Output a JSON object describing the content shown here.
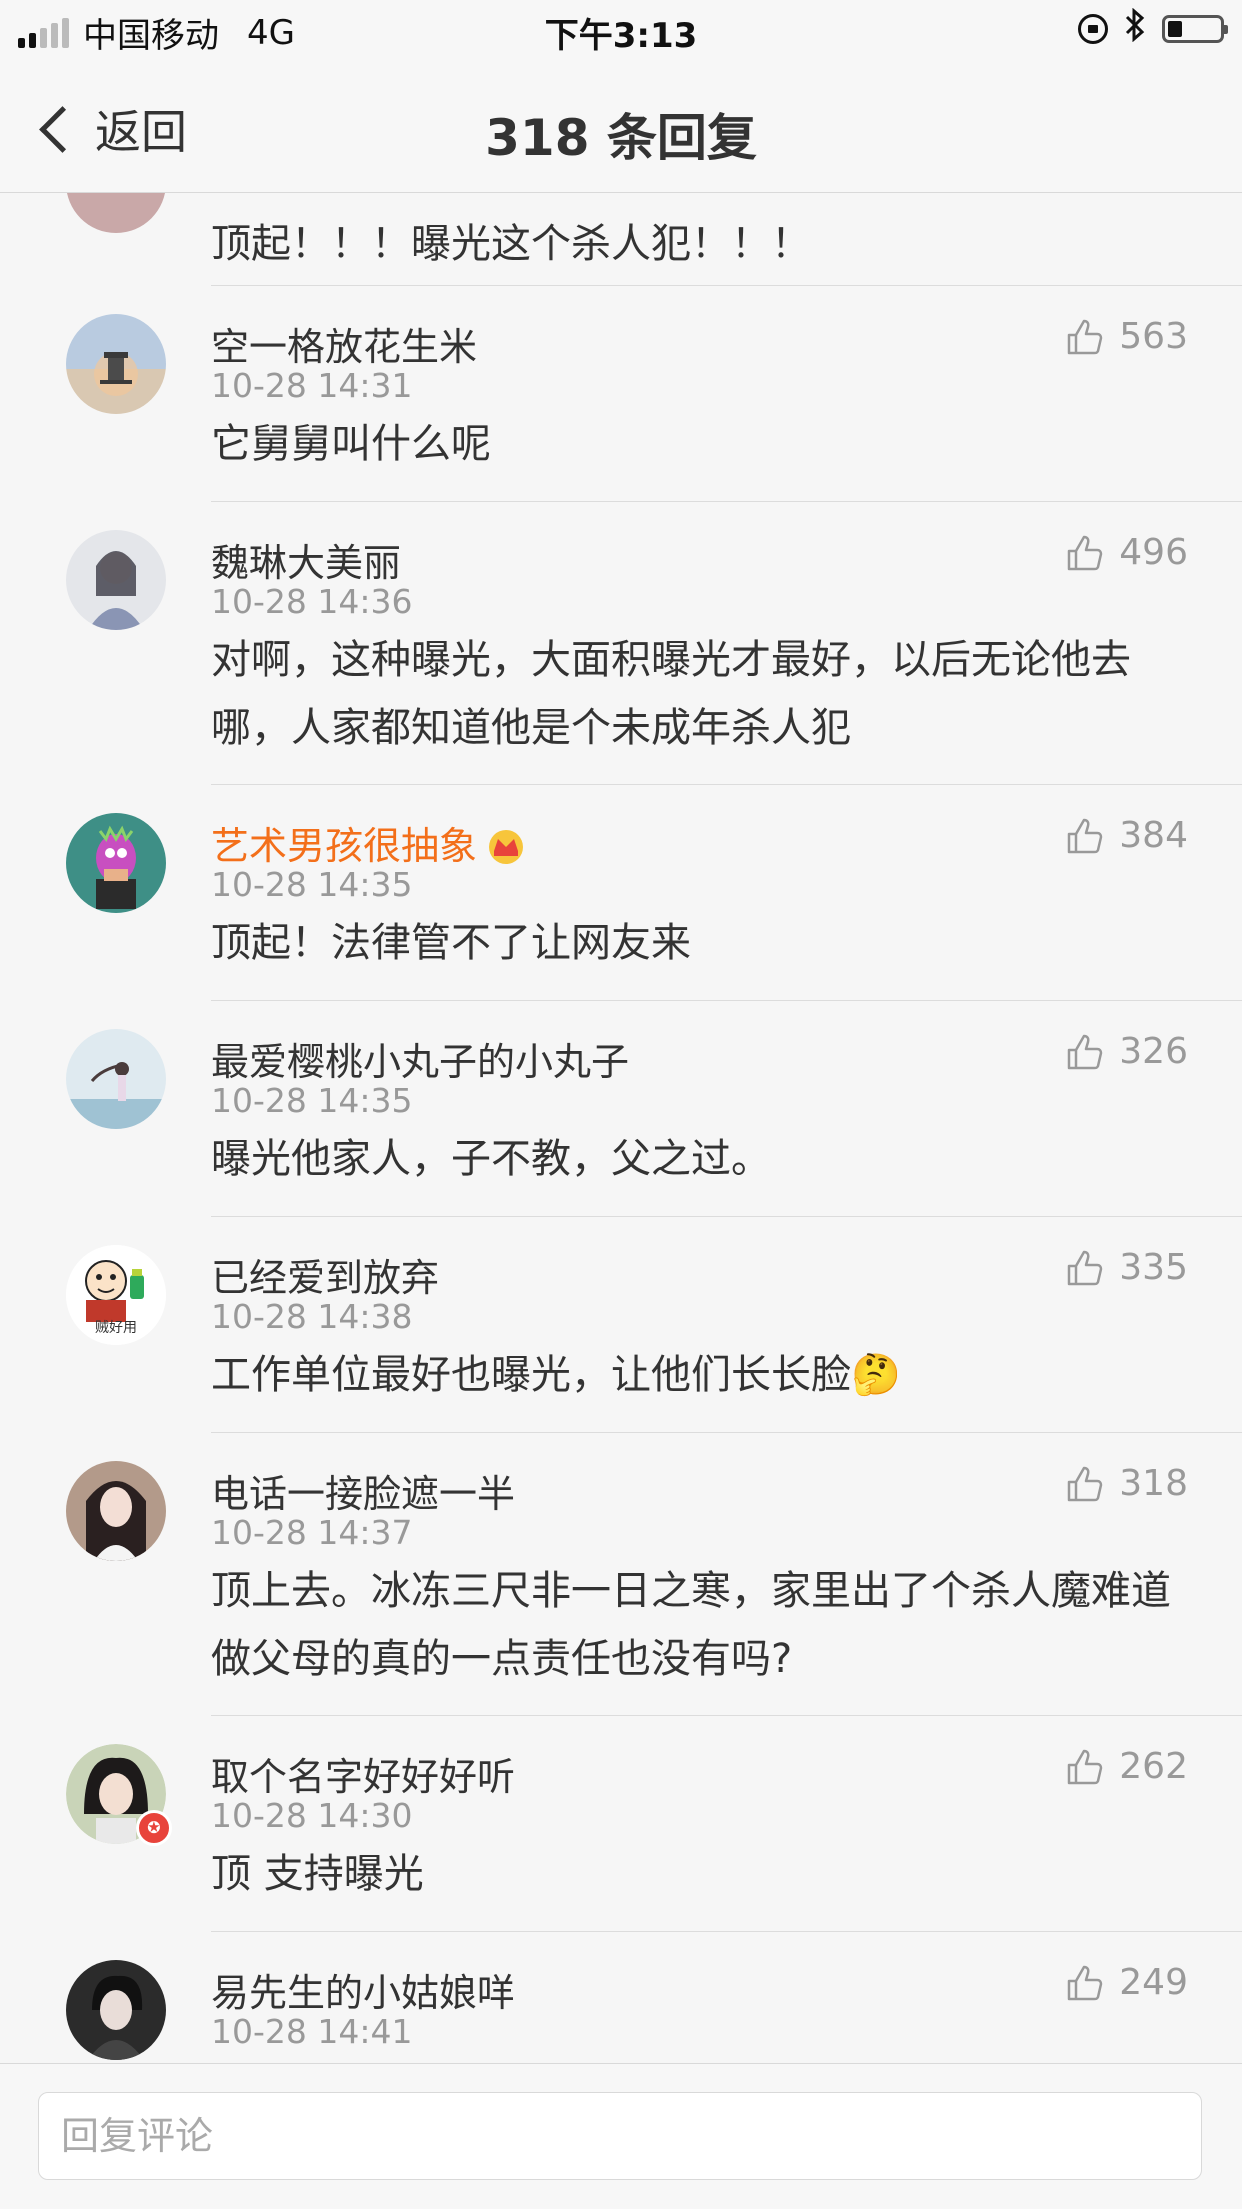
{
  "status_bar": {
    "carrier": "中国移动",
    "network": "4G",
    "time": "下午3:13"
  },
  "nav": {
    "back_label": "返回",
    "title": "318 条回复"
  },
  "partial_comment": {
    "text": "顶起！！！曝光这个杀人犯！！！"
  },
  "comments": [
    {
      "name": "空一格放花生米",
      "time": "10-28 14:31",
      "likes": "563",
      "text": "它舅舅叫什么呢"
    },
    {
      "name": "魏琳大美丽",
      "time": "10-28 14:36",
      "likes": "496",
      "text": "对啊，这种曝光，大面积曝光才最好，以后无论他去哪，人家都知道他是个未成年杀人犯"
    },
    {
      "name": "艺术男孩很抽象",
      "time": "10-28 14:35",
      "likes": "384",
      "text": "顶起！法律管不了让网友来",
      "vip": true
    },
    {
      "name": "最爱樱桃小丸子的小丸子",
      "time": "10-28 14:35",
      "likes": "326",
      "text": "曝光他家人，子不教，父之过。"
    },
    {
      "name": "已经爱到放弃",
      "time": "10-28 14:38",
      "likes": "335",
      "text": "工作单位最好也曝光，让他们长长脸🤔",
      "avatar_caption": "贼好用"
    },
    {
      "name": "电话一接脸遮一半",
      "time": "10-28 14:37",
      "likes": "318",
      "text": "顶上去。冰冻三尺非一日之寒，家里出了个杀人魔难道做父母的真的一点责任也没有吗?"
    },
    {
      "name": "取个名字好好好听",
      "time": "10-28 14:30",
      "likes": "262",
      "text": "顶 支持曝光"
    },
    {
      "name": "易先生的小姑娘咩",
      "time": "10-28 14:41",
      "likes": "249",
      "text": ""
    }
  ],
  "reply_input": {
    "placeholder": "回复评论"
  },
  "colors": {
    "vip_name": "#f36f1a",
    "meta": "#999999",
    "text": "#333333"
  }
}
